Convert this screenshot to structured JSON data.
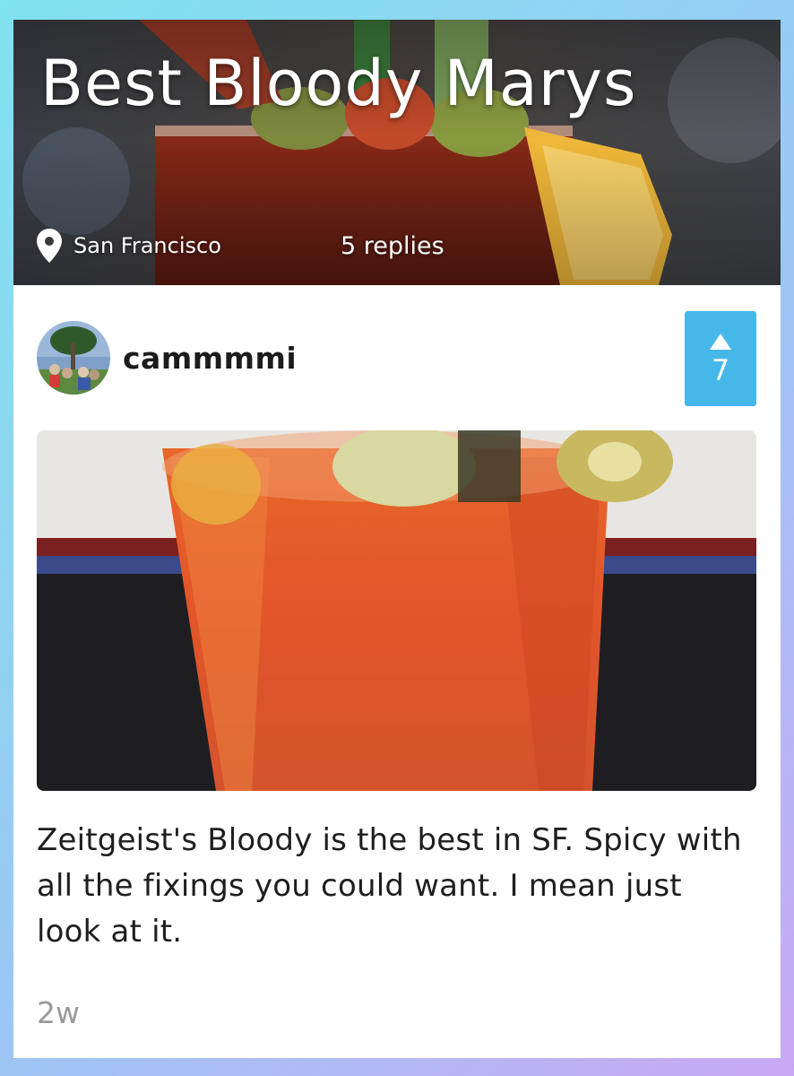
{
  "header": {
    "title": "Best Bloody Marys",
    "location": "San Francisco",
    "replies": "5 replies",
    "location_icon": "map-pin-icon"
  },
  "post": {
    "username": "cammmmi",
    "upvote_icon": "triangle-up-icon",
    "vote_count": "7",
    "body": "Zeitgeist's Bloody is the best in SF. Spicy with all the fixings you could want. I mean just look at it.",
    "timestamp": "2w"
  },
  "colors": {
    "vote_button": "#45b7e9",
    "page_gradient_start": "#7fe3f0",
    "page_gradient_end": "#c9a8f5",
    "timestamp": "#9a9a9a"
  }
}
